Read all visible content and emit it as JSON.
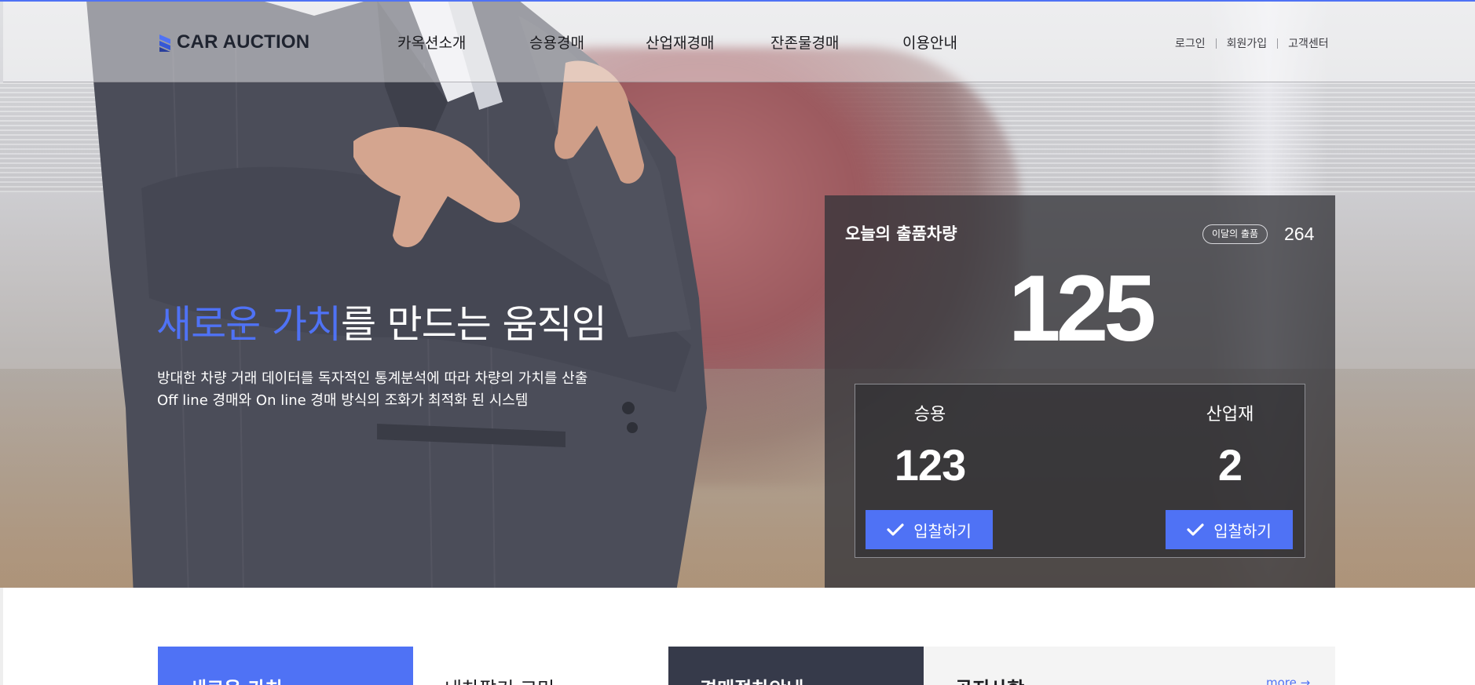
{
  "header": {
    "logo_text": "CAR AUCTION",
    "nav": [
      "카옥션소개",
      "승용경매",
      "산업재경매",
      "잔존물경매",
      "이용안내"
    ],
    "util": [
      "로그인",
      "회원가입",
      "고객센터"
    ]
  },
  "hero": {
    "title_accent": "새로운 가치",
    "title_rest": "를 만드는 움직임",
    "desc_line1": "방대한 차량 거래 데이터를 독자적인 통계분석에 따라 차량의 가치를 산출",
    "desc_line2": "Off line 경매와 On line 경매 방식의 조화가 최적화 된 시스템"
  },
  "stats": {
    "title": "오늘의 출품차량",
    "month_badge": "이달의 출품",
    "month_count": "264",
    "total": "125",
    "categories": [
      {
        "label": "승용",
        "value": "123",
        "button": "입찰하기"
      },
      {
        "label": "산업재",
        "value": "2",
        "button": "입찰하기"
      }
    ]
  },
  "cards": [
    {
      "title": "새로운 가치"
    },
    {
      "title": "내차팔기 고민"
    },
    {
      "title": "경매절차안내"
    },
    {
      "title": "공지사항",
      "more": "more →"
    }
  ],
  "colors": {
    "accent": "#4f72f5",
    "panel": "#34343a",
    "dark_card": "#363a4a"
  },
  "icons": [
    "logo-mark-icon",
    "check-icon"
  ]
}
